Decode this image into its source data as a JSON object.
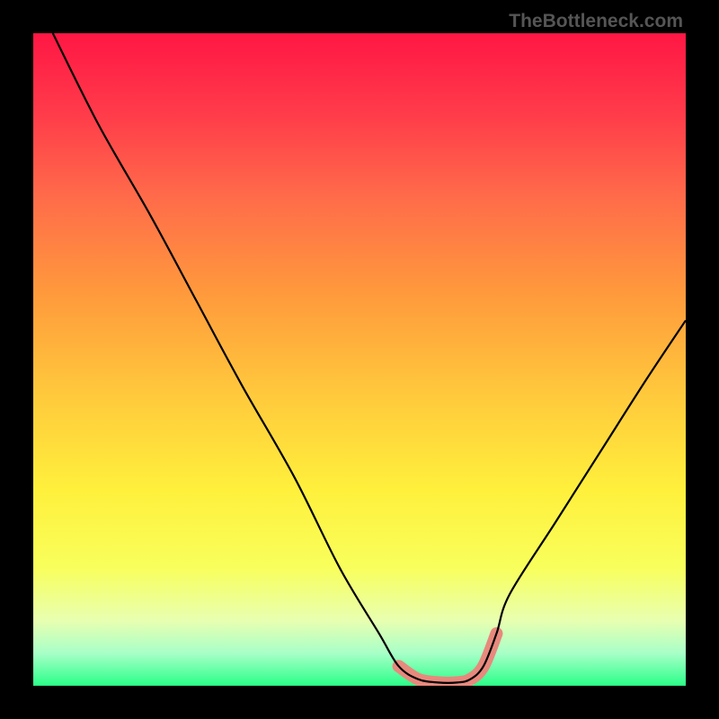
{
  "watermark": "TheBottleneck.com",
  "chart_data": {
    "type": "line",
    "title": "",
    "xlabel": "",
    "ylabel": "",
    "xlim": [
      0,
      100
    ],
    "ylim": [
      0,
      100
    ],
    "series": [
      {
        "name": "bottleneck-curve",
        "color": "#000000",
        "x": [
          3,
          10,
          18,
          25,
          32,
          40,
          47,
          53,
          56,
          59,
          62,
          65,
          67,
          69,
          71,
          73,
          80,
          87,
          94,
          100
        ],
        "y": [
          100,
          86,
          72,
          59,
          46,
          32,
          18,
          8,
          3,
          1,
          0.5,
          0.5,
          1,
          3,
          8,
          14,
          25,
          36,
          47,
          56
        ]
      }
    ],
    "highlight_region": {
      "name": "optimal-range",
      "color": "#e8897d",
      "x_start": 56,
      "x_end": 71
    },
    "background_gradient": {
      "type": "vertical",
      "stops": [
        {
          "pos": 0.0,
          "color": "#ff1744"
        },
        {
          "pos": 0.12,
          "color": "#ff3a4a"
        },
        {
          "pos": 0.25,
          "color": "#ff6b4a"
        },
        {
          "pos": 0.4,
          "color": "#ff9a3c"
        },
        {
          "pos": 0.55,
          "color": "#ffc83c"
        },
        {
          "pos": 0.7,
          "color": "#fff03c"
        },
        {
          "pos": 0.82,
          "color": "#f8ff5c"
        },
        {
          "pos": 0.9,
          "color": "#e8ffb0"
        },
        {
          "pos": 0.95,
          "color": "#a8ffc8"
        },
        {
          "pos": 1.0,
          "color": "#2aff88"
        }
      ]
    }
  }
}
